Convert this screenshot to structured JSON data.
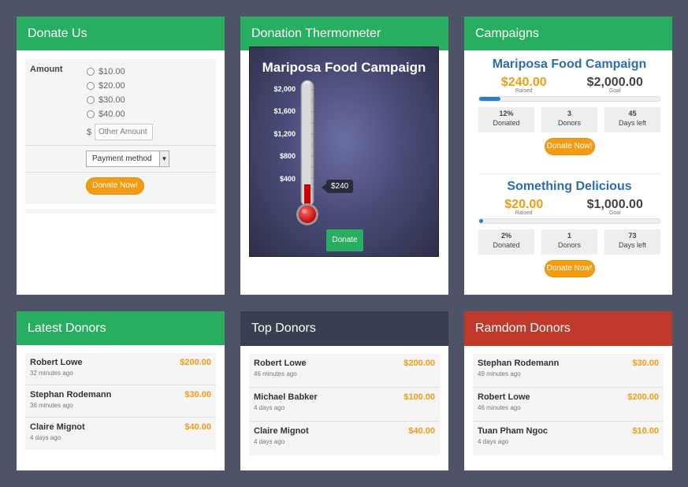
{
  "donate_us": {
    "title": "Donate Us",
    "amount_label": "Amount",
    "options": [
      "$10.00",
      "$20.00",
      "$30.00",
      "$40.00"
    ],
    "currency_symbol": "$",
    "other_placeholder": "Other Amount",
    "payment_method": "Payment method",
    "button": "Donate Now!"
  },
  "thermometer": {
    "title": "Donation Thermometer",
    "campaign": "Mariposa Food Campaign",
    "ticks": [
      "$2,000",
      "$1,600",
      "$1,200",
      "$800",
      "$400"
    ],
    "current": "$240",
    "button": "Donate"
  },
  "campaigns": {
    "title": "Campaigns",
    "items": [
      {
        "name": "Mariposa Food Campaign",
        "raised": "$240.00",
        "raised_label": "Raised",
        "goal": "$2,000.00",
        "goal_label": "Goal",
        "progress": 0.12,
        "pct": "12%",
        "pct_label": "Donated",
        "donors": "3",
        "donors_label": "Donors",
        "days": "45",
        "days_label": "Days left",
        "button": "Donate Now!"
      },
      {
        "name": "Something Delicious",
        "raised": "$20.00",
        "raised_label": "Raised",
        "goal": "$1,000.00",
        "goal_label": "Goal",
        "progress": 0.02,
        "pct": "2%",
        "pct_label": "Donated",
        "donors": "1",
        "donors_label": "Donors",
        "days": "73",
        "days_label": "Days left",
        "button": "Donate Now!"
      }
    ]
  },
  "latest_donors": {
    "title": "Latest Donors",
    "items": [
      {
        "name": "Robert Lowe",
        "time": "32 minutes ago",
        "amount": "$200.00"
      },
      {
        "name": "Stephan Rodemann",
        "time": "36 minutes ago",
        "amount": "$30.00"
      },
      {
        "name": "Claire Mignot",
        "time": "4 days ago",
        "amount": "$40.00"
      }
    ]
  },
  "top_donors": {
    "title": "Top Donors",
    "items": [
      {
        "name": "Robert Lowe",
        "time": "46 minutes ago",
        "amount": "$200.00"
      },
      {
        "name": "Michael Babker",
        "time": "4 days ago",
        "amount": "$100.00"
      },
      {
        "name": "Claire Mignot",
        "time": "4 days ago",
        "amount": "$40.00"
      }
    ]
  },
  "random_donors": {
    "title": "Ramdom Donors",
    "items": [
      {
        "name": "Stephan Rodemann",
        "time": "49 minutes ago",
        "amount": "$30.00"
      },
      {
        "name": "Robert Lowe",
        "time": "46 minutes ago",
        "amount": "$200.00"
      },
      {
        "name": "Tuan Pham Ngoc",
        "time": "4 days ago",
        "amount": "$10.00"
      }
    ]
  },
  "colors": {
    "green": "#27ae60",
    "orange": "#f39c12",
    "dark": "#3a3e52",
    "red": "#c0392b",
    "blue": "#2a6db0"
  }
}
